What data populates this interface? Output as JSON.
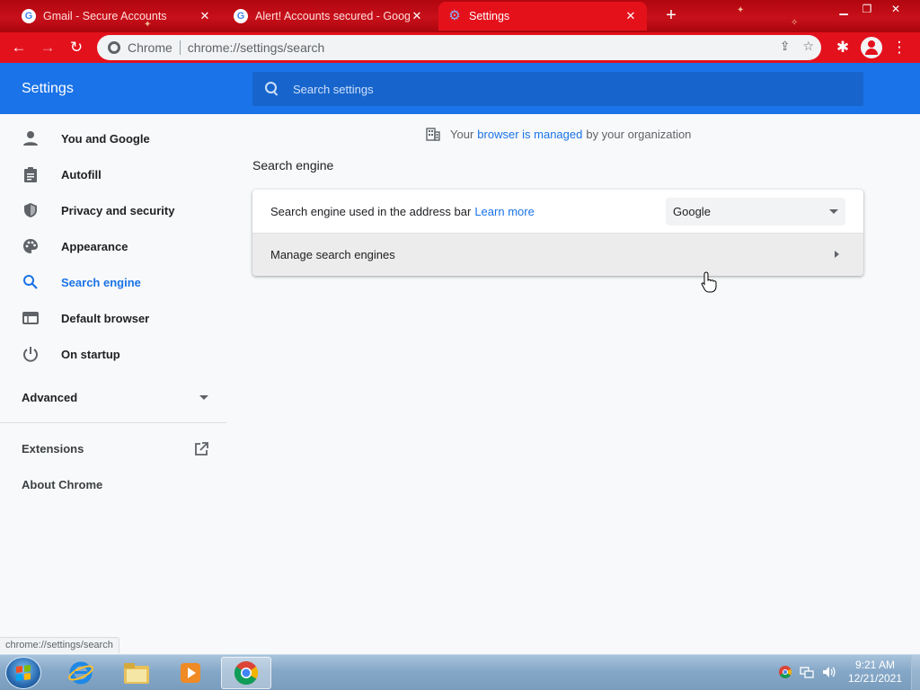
{
  "browser": {
    "tabs": [
      {
        "title": "Gmail - Secure Accounts",
        "favicon": "google-g-icon",
        "active": false
      },
      {
        "title": "Alert! Accounts secured - Google",
        "favicon": "google-g-icon",
        "active": false
      },
      {
        "title": "Settings",
        "favicon": "settings-gear-icon",
        "active": true
      }
    ],
    "omnibox": {
      "chip": "Chrome",
      "url": "chrome://settings/search"
    },
    "theme_color": "#e3111c"
  },
  "settings": {
    "header_title": "Settings",
    "search_placeholder": "Search settings",
    "sidebar": {
      "items": [
        {
          "label": "You and Google",
          "icon": "person-icon"
        },
        {
          "label": "Autofill",
          "icon": "clipboard-icon"
        },
        {
          "label": "Privacy and security",
          "icon": "shield-icon"
        },
        {
          "label": "Appearance",
          "icon": "palette-icon"
        },
        {
          "label": "Search engine",
          "icon": "search-icon",
          "selected": true
        },
        {
          "label": "Default browser",
          "icon": "browser-window-icon"
        },
        {
          "label": "On startup",
          "icon": "power-icon"
        }
      ],
      "advanced": "Advanced",
      "extensions": "Extensions",
      "about": "About Chrome"
    },
    "managed": {
      "prefix": "Your",
      "link": "browser is managed",
      "suffix": "by your organization"
    },
    "section_title": "Search engine",
    "card": {
      "row1_label": "Search engine used in the address bar",
      "row1_link": "Learn more",
      "engine_value": "Google",
      "row2_label": "Manage search engines"
    }
  },
  "statusbar": {
    "text": "chrome://settings/search"
  },
  "taskbar": {
    "apps": [
      "internet-explorer-icon",
      "file-explorer-icon",
      "media-player-icon",
      "chrome-icon"
    ],
    "time": "9:21 AM",
    "date": "12/21/2021"
  },
  "accent_color": "#1a73e8"
}
